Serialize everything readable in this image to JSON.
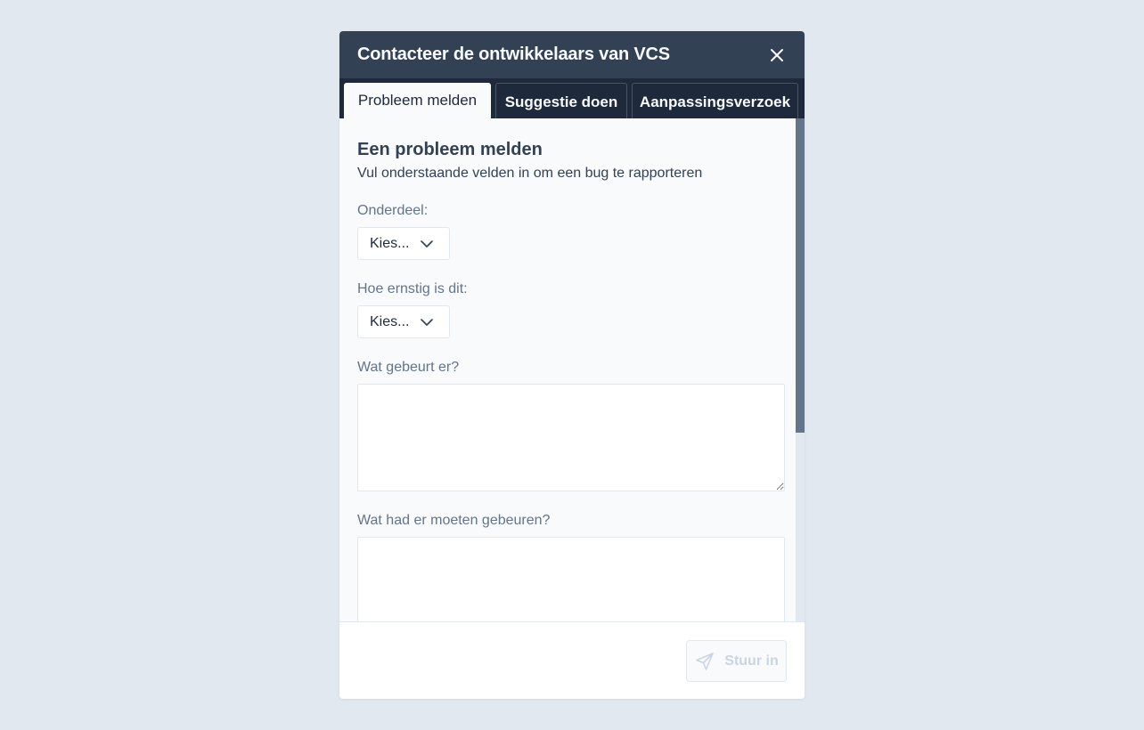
{
  "dialog": {
    "title": "Contacteer de ontwikkelaars van VCS"
  },
  "tabs": [
    {
      "label": "Probleem melden",
      "active": true
    },
    {
      "label": "Suggestie doen",
      "active": false
    },
    {
      "label": "Aanpassingsverzoek",
      "active": false
    }
  ],
  "form": {
    "title": "Een probleem melden",
    "subtitle": "Vul onderstaande velden in om een bug te rapporteren",
    "component": {
      "label": "Onderdeel:",
      "value": "Kies..."
    },
    "severity": {
      "label": "Hoe ernstig is dit:",
      "value": "Kies..."
    },
    "what_happens": {
      "label": "Wat gebeurt er?",
      "value": ""
    },
    "expected": {
      "label": "Wat had er moeten gebeuren?",
      "value": ""
    }
  },
  "footer": {
    "submit_label": "Stuur in",
    "submit_enabled": false
  },
  "scroll": {
    "position": 0
  },
  "icons": {
    "close": "close-icon",
    "chevron": "chevron-down-icon",
    "send": "send-icon"
  },
  "colors": {
    "header": "#334155",
    "tabbar": "#1e293b",
    "content": "#f8fafc",
    "background": "#e2e8f0",
    "scroll_thumb": "#64748b"
  }
}
